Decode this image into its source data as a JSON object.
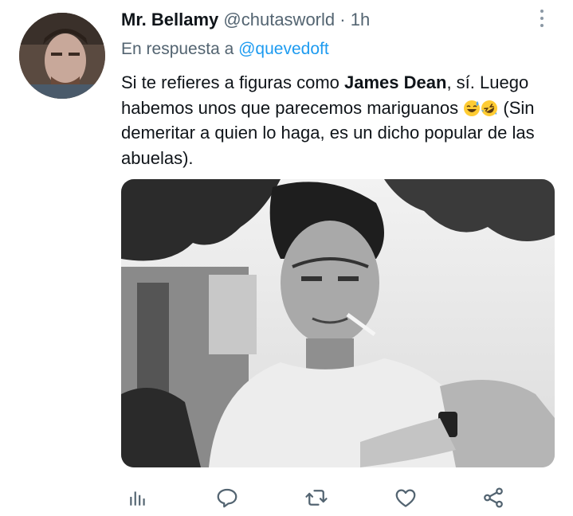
{
  "tweet": {
    "author_name": "Mr. Bellamy",
    "handle": "@chutasworld",
    "separator": "·",
    "time": "1h",
    "reply_prefix": "En respuesta a",
    "reply_to": "@quevedoft",
    "text_part1": "Si te refieres a figuras como ",
    "text_bold": "James Dean",
    "text_part2": ", sí. Luego habemos unos que parecemos mariguanos ",
    "text_part3": " (Sin demeritar a quien lo haga, es un dicho popular de las abuelas).",
    "emojis": [
      "sweat-smile-emoji",
      "rofl-emoji"
    ]
  },
  "actions": {
    "items": [
      "analytics-icon",
      "reply-icon",
      "retweet-icon",
      "like-icon",
      "share-icon"
    ]
  },
  "colors": {
    "accent": "#1d9bf0",
    "muted": "#536471",
    "icon": "#536471"
  }
}
